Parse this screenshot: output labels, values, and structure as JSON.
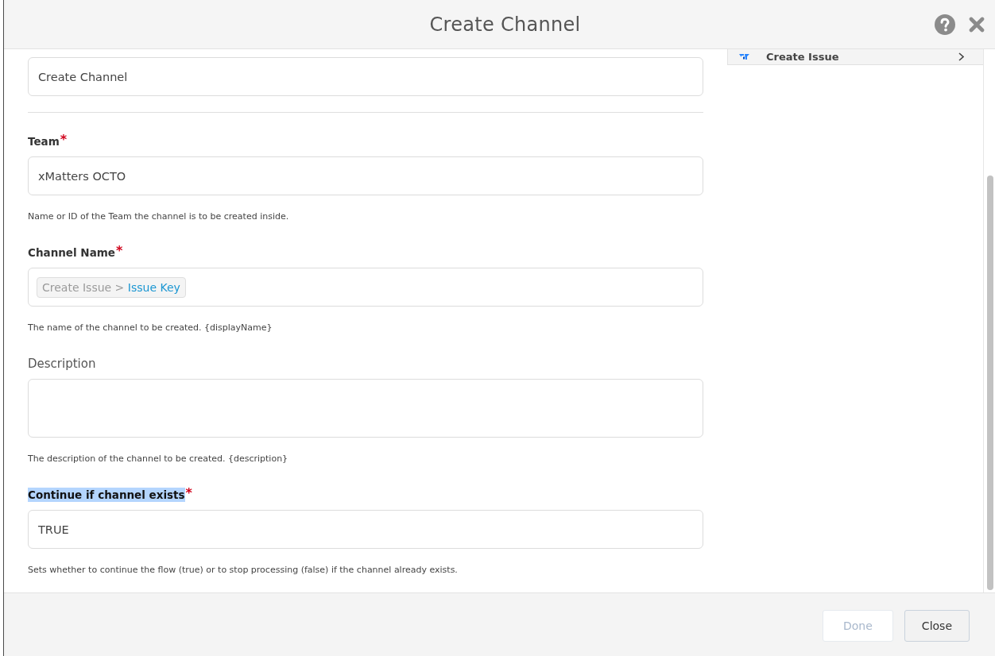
{
  "dialog": {
    "title": "Create Channel"
  },
  "form": {
    "step_name": {
      "value": "Create Channel"
    },
    "fields": [
      {
        "kind": "text",
        "label": "Team",
        "required": true,
        "required_mark": "*",
        "highlighted": false,
        "value": "xMatters OCTO",
        "help": "Name or ID of the Team the channel is to be created inside."
      },
      {
        "kind": "token",
        "label": "Channel Name",
        "required": true,
        "required_mark": "*",
        "highlighted": false,
        "token": {
          "path": "Create Issue >",
          "property": "Issue Key"
        },
        "help": "The name of the channel to be created. {displayName}"
      },
      {
        "kind": "textarea",
        "label": "Description",
        "required": false,
        "highlighted": false,
        "help": "The description of the channel to be created. {description}"
      },
      {
        "kind": "text",
        "label": "Continue if channel exists",
        "required": true,
        "required_mark": "*",
        "highlighted": true,
        "value": "TRUE",
        "help": "Sets whether to continue the flow (true) or to stop processing (false) if the channel already exists."
      }
    ]
  },
  "steps_panel": {
    "items": [
      {
        "label": "Create Issue"
      }
    ]
  },
  "footer": {
    "buttons": [
      {
        "label": "Done",
        "disabled": true
      },
      {
        "label": "Close",
        "disabled": false
      }
    ]
  }
}
